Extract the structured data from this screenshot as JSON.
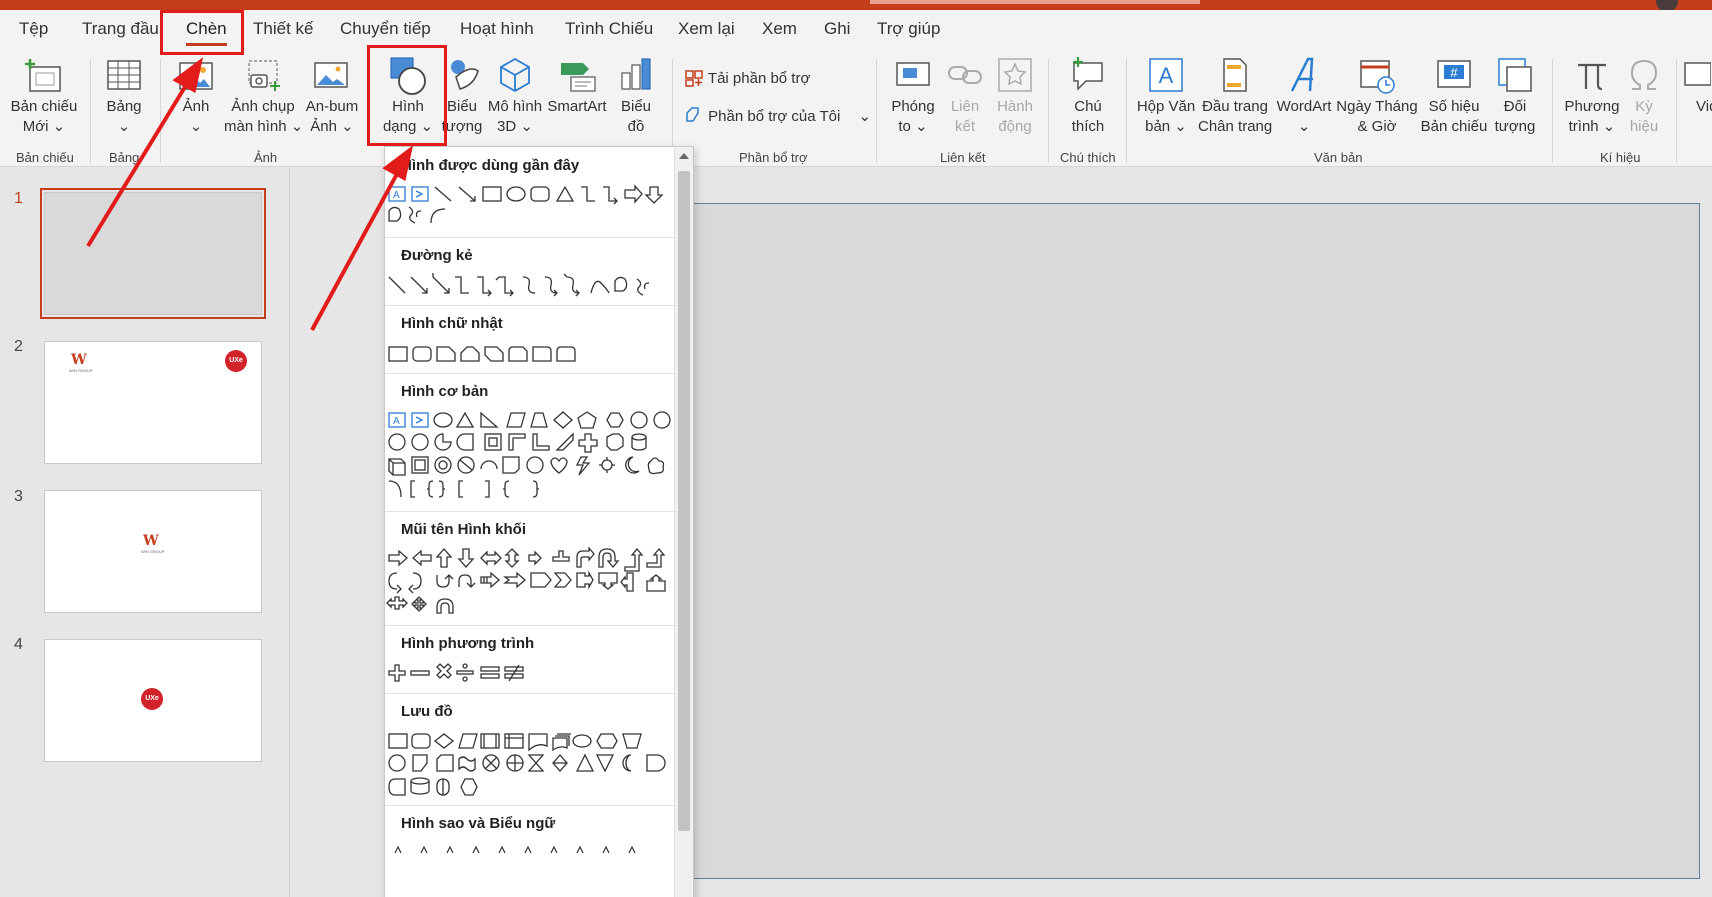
{
  "menu": {
    "tabs": [
      "Tệp",
      "Trang đầu",
      "Chèn",
      "Thiết kế",
      "Chuyển tiếp",
      "Hoạt hình",
      "Trình Chiếu",
      "Xem lại",
      "Xem",
      "Ghi",
      "Trợ giúp"
    ],
    "active_tab": "Chèn"
  },
  "ribbon": {
    "buttons": {
      "new_slide": [
        "Bản chiếu",
        "Mới ⌄"
      ],
      "table": [
        "Bảng",
        "⌄"
      ],
      "pictures": [
        "Ảnh",
        "⌄"
      ],
      "screenshot": [
        "Ảnh chụp",
        "màn hình ⌄"
      ],
      "album": [
        "An-bum",
        "Ảnh ⌄"
      ],
      "shapes": [
        "Hình",
        "dạng ⌄"
      ],
      "icons": [
        "Biểu",
        "tượng"
      ],
      "models3d": [
        "Mô hình",
        "3D ⌄"
      ],
      "smartart": [
        "SmartArt",
        ""
      ],
      "chart": [
        "Biểu",
        "đồ"
      ],
      "zoom": [
        "Phóng",
        "to ⌄"
      ],
      "link": [
        "Liên",
        "kết"
      ],
      "action": [
        "Hành",
        "động"
      ],
      "comment": [
        "Chú",
        "thích"
      ],
      "textbox": [
        "Hộp Văn",
        "bản ⌄"
      ],
      "header": [
        "Đầu trang",
        "Chân trang"
      ],
      "wordart": [
        "WordArt",
        "⌄"
      ],
      "datetime": [
        "Ngày Tháng",
        "& Giờ"
      ],
      "slidenum": [
        "Số hiệu",
        "Bản chiếu"
      ],
      "object": [
        "Đối",
        "tượng"
      ],
      "equation": [
        "Phương",
        "trình ⌄"
      ],
      "symbol": [
        "Kỳ",
        "hiệu"
      ],
      "video": [
        "Vid",
        ""
      ]
    },
    "addins": {
      "get": "Tải phần bổ trợ",
      "my": "Phần bổ trợ của Tôi"
    },
    "groups": {
      "slides": "Bản chiếu",
      "tables": "Bảng",
      "images": "Ảnh",
      "addins": "Phần bổ trợ",
      "links": "Liên kết",
      "comments": "Chú thích",
      "text": "Văn bản",
      "symbols": "Kí hiệu"
    }
  },
  "shapes_menu": {
    "sections": {
      "recent": "Hình được dùng gần đây",
      "lines": "Đường kẻ",
      "rectangles": "Hình chữ nhật",
      "basic": "Hình cơ bản",
      "block_arrows": "Mũi tên Hình khối",
      "equation": "Hình phương trình",
      "flowchart": "Lưu đồ",
      "stars": "Hình sao và Biểu ngữ"
    }
  },
  "slides_pane": {
    "numbers": [
      "1",
      "2",
      "3",
      "4"
    ],
    "logo_w": "W",
    "logo_sub": "WIN GROUP",
    "logo_circle": "UXe"
  },
  "colors": {
    "accent": "#c43e1c",
    "highlight": "#e21b1b"
  }
}
